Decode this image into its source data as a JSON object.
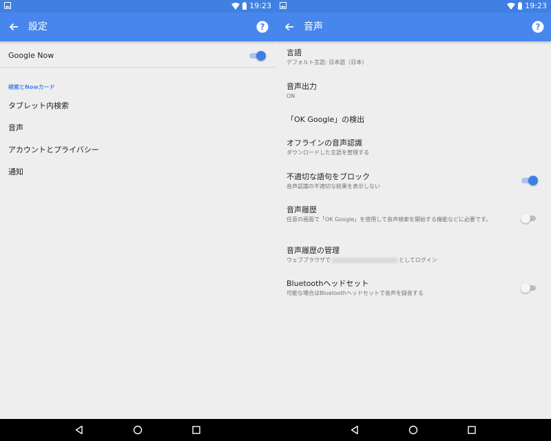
{
  "status": {
    "time": "19:23"
  },
  "left": {
    "title": "設定",
    "google_now": {
      "label": "Google Now",
      "on": true
    },
    "section_header": "検索とNowカード",
    "items": [
      "タブレット内検索",
      "音声",
      "アカウントとプライバシー",
      "通知"
    ]
  },
  "right": {
    "title": "音声",
    "items": [
      {
        "title": "言語",
        "subtitle": "デフォルト言語: 日本語（日本）"
      },
      {
        "title": "音声出力",
        "subtitle": "ON"
      },
      {
        "title": "「OK Google」の検出",
        "subtitle": ""
      },
      {
        "title": "オフラインの音声認識",
        "subtitle": "ダウンロードした言語を管理する"
      },
      {
        "title": "不適切な語句をブロック",
        "subtitle": "音声認識の不適切な結果を表示しない",
        "toggle": true
      },
      {
        "title": "音声履歴",
        "subtitle": "任意の画面で「OK Google」を使用して音声検索を開始する機能などに必要です。",
        "toggle": false
      },
      {
        "title": "音声履歴の管理",
        "subtitle_pre": "ウェブブラウザで",
        "subtitle_post": "としてログイン"
      },
      {
        "title": "Bluetoothヘッドセット",
        "subtitle": "可能な場合はBluetoothヘッドセットで音声を録音する",
        "toggle": false
      }
    ]
  },
  "colors": {
    "status_bar": "#3f80e0",
    "app_bar": "#4787ed",
    "accent": "#3d7fe6"
  },
  "icons": [
    "back-arrow-icon",
    "help-icon",
    "wifi-icon",
    "battery-icon",
    "nav-back-icon",
    "nav-home-icon",
    "nav-recents-icon"
  ]
}
